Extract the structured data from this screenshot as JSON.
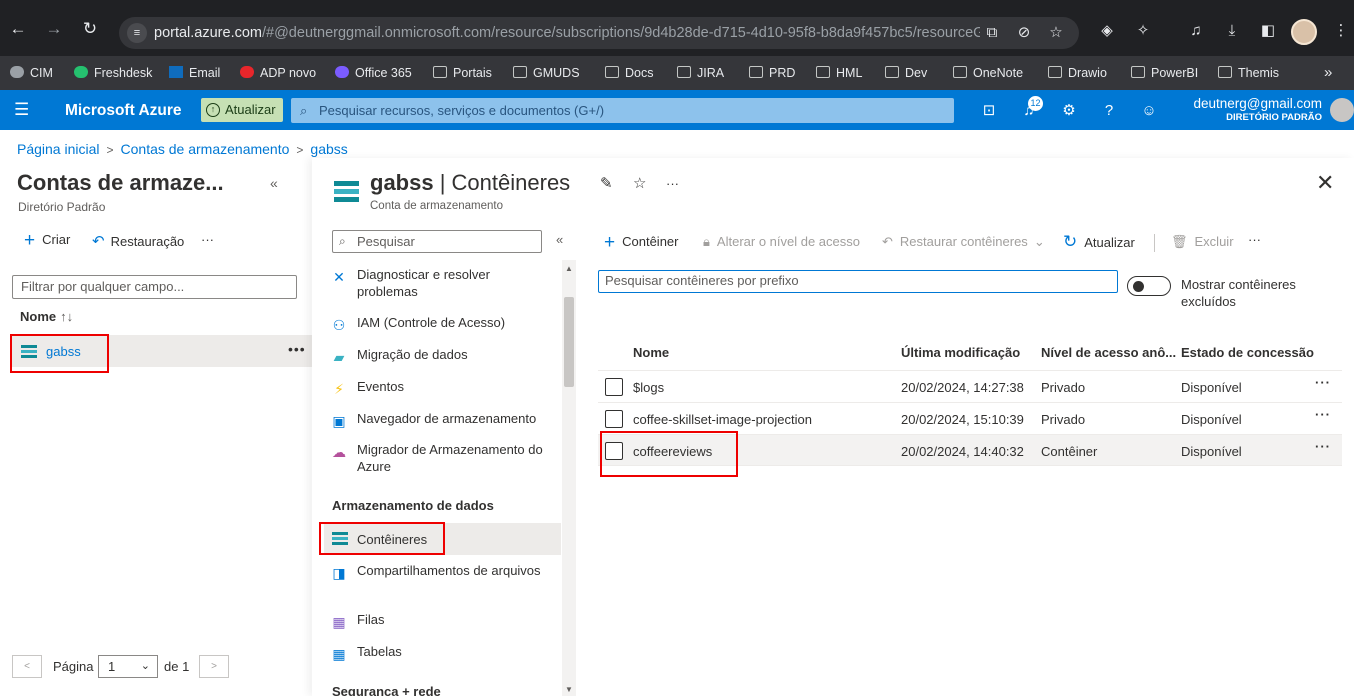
{
  "browser": {
    "url_host": "portal.azure.com",
    "url_path": "/#@deutnerggmail.onmicrosoft.com/resource/subscriptions/9d4b28de-d715-4d10-95f8-b8da9f457bc5/resourceGr...",
    "bookmarks": [
      "CIM",
      "Freshdesk",
      "Email",
      "ADP novo",
      "Office 365",
      "Portais",
      "GMUDS",
      "Docs",
      "JIRA",
      "PRD",
      "HML",
      "Dev",
      "OneNote",
      "Drawio",
      "PowerBI",
      "Themis"
    ],
    "overflow": "»"
  },
  "azure": {
    "brand": "Microsoft Azure",
    "upgrade_label": "Atualizar",
    "search_placeholder": "Pesquisar recursos, serviços e documentos (G+/)",
    "notification_count": "12",
    "account_email": "deutnerg@gmail.com",
    "account_directory": "DIRETÓRIO PADRÃO"
  },
  "breadcrumb": [
    "Página inicial",
    "Contas de armazenamento",
    "gabss"
  ],
  "left": {
    "title": "Contas de armaze...",
    "subtitle": "Diretório Padrão",
    "create_label": "Criar",
    "restore_label": "Restauração",
    "more": "···",
    "filter_placeholder": "Filtrar por qualquer campo...",
    "name_header": "Nome",
    "sort_icon": "↑↓",
    "item": "gabss",
    "pager": {
      "page_label": "Página",
      "page_value": "1",
      "of_label": "de 1"
    }
  },
  "blade": {
    "resource": "gabss",
    "section": "Contêineres",
    "subtitle": "Conta de armazenamento",
    "menu_search": "Pesquisar",
    "menu": [
      {
        "label": "Diagnosticar e resolver problemas",
        "icon": "wrench-icon"
      },
      {
        "label": "IAM (Controle de Acesso)",
        "icon": "people-icon"
      },
      {
        "label": "Migração de dados",
        "icon": "migration-icon"
      },
      {
        "label": "Eventos",
        "icon": "lightning-icon"
      },
      {
        "label": "Navegador de armazenamento",
        "icon": "storage-browser-icon"
      },
      {
        "label": "Migrador de Armazenamento do Azure",
        "icon": "migrator-icon"
      }
    ],
    "section_storage": "Armazenamento de dados",
    "storage_items": [
      {
        "label": "Contêineres",
        "icon": "containers-icon"
      },
      {
        "label": "Compartilhamentos de arquivos",
        "icon": "file-shares-icon"
      },
      {
        "label": "Filas",
        "icon": "queues-icon"
      },
      {
        "label": "Tabelas",
        "icon": "tables-icon"
      }
    ],
    "section_security": "Segurança + rede",
    "toolbar": {
      "add": "Contêiner",
      "access": "Alterar o nível de acesso",
      "restore": "Restaurar contêineres",
      "refresh": "Atualizar",
      "delete": "Excluir",
      "more": "···"
    },
    "container_search_placeholder": "Pesquisar contêineres por prefixo",
    "show_deleted_label": "Mostrar contêineres excluídos",
    "columns": [
      "Nome",
      "Última modificação",
      "Nível de acesso anô...",
      "Estado de concessão"
    ],
    "rows": [
      {
        "name": "$logs",
        "modified": "20/02/2024, 14:27:38",
        "access": "Privado",
        "lease": "Disponível"
      },
      {
        "name": "coffee-skillset-image-projection",
        "modified": "20/02/2024, 15:10:39",
        "access": "Privado",
        "lease": "Disponível"
      },
      {
        "name": "coffeereviews",
        "modified": "20/02/2024, 14:40:32",
        "access": "Contêiner",
        "lease": "Disponível"
      }
    ],
    "row_more": "···"
  },
  "colors": {
    "azure_blue": "#0078d4",
    "highlight_red": "#e00000",
    "browser_dark": "#202124"
  }
}
